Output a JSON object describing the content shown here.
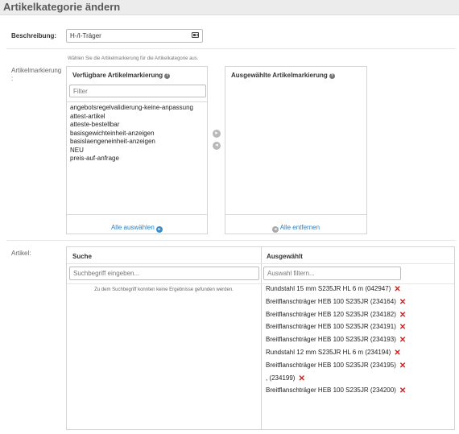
{
  "page": {
    "title": "Artikelkategorie ändern"
  },
  "description": {
    "label": "Beschreibung:",
    "value": "H-/I-Träger"
  },
  "marking": {
    "label": "Artikelmarkierung :",
    "hint": "Wählen Sie die Artikelmarkierung für die Artikelkategorie aus.",
    "available": {
      "title": "Verfügbare Artikelmarkierung",
      "filter_placeholder": "Filter",
      "items": [
        "angebotsregelvalidierung-keine-anpassung",
        "attest-artikel",
        "atteste-bestellbar",
        "basisgewichteinheit-anzeigen",
        "basislaengeneinheit-anzeigen",
        "NEU",
        "preis-auf-anfrage"
      ],
      "select_all": "Alle auswählen"
    },
    "selected": {
      "title": "Ausgewählte Artikelmarkierung",
      "remove_all": "Alle entfernen"
    }
  },
  "articles": {
    "label": "Artikel:",
    "search": {
      "title": "Suche",
      "placeholder": "Suchbegriff eingeben...",
      "empty_message": "Zu dem Suchbegriff konnten keine Ergebnisse gefunden werden."
    },
    "selected": {
      "title": "Ausgewählt",
      "placeholder": "Auswahl filtern...",
      "items": [
        "Rundstahl 15 mm S235JR HL 6 m (042947)",
        "Breitflanschträger HEB 100 S235JR (234164)",
        "Breitflanschträger HEB 120 S235JR (234182)",
        "Breitflanschträger HEB 100 S235JR (234191)",
        "Breitflanschträger HEB 100 S235JR (234193)",
        "Rundstahl 12 mm S235JR HL 6 m (234194)",
        "Breitflanschträger HEB 100 S235JR (234195)",
        ", (234199)",
        "Breitflanschträger HEB 100 S235JR (234200)"
      ]
    }
  }
}
